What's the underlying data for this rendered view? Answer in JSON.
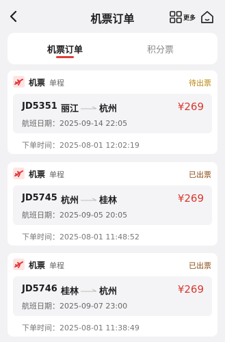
{
  "header": {
    "title": "机票订单",
    "more_label": "更多"
  },
  "tabs": [
    {
      "label": "机票订单"
    },
    {
      "label": "积分票"
    }
  ],
  "colors": {
    "accent": "#e03a3a",
    "price": "#d9372c",
    "status_pending": "#b8860b",
    "status_issued": "#8a4b12"
  },
  "orders": [
    {
      "type": "机票",
      "trip": "单程",
      "status": "待出票",
      "flight_no": "JD5351",
      "from": "丽江",
      "to": "杭州",
      "price": "¥269",
      "flight_date": "航班日期：2025-09-14 22:05",
      "order_time": "下单时间：2025-08-01 12:02:19"
    },
    {
      "type": "机票",
      "trip": "单程",
      "status": "已出票",
      "flight_no": "JD5745",
      "from": "杭州",
      "to": "桂林",
      "price": "¥269",
      "flight_date": "航班日期：2025-09-05 20:05",
      "order_time": "下单时间：2025-08-01 11:48:52"
    },
    {
      "type": "机票",
      "trip": "单程",
      "status": "已出票",
      "flight_no": "JD5746",
      "from": "桂林",
      "to": "杭州",
      "price": "¥269",
      "flight_date": "航班日期：2025-09-07 23:00",
      "order_time": "下单时间：2025-08-01 11:38:49"
    }
  ]
}
